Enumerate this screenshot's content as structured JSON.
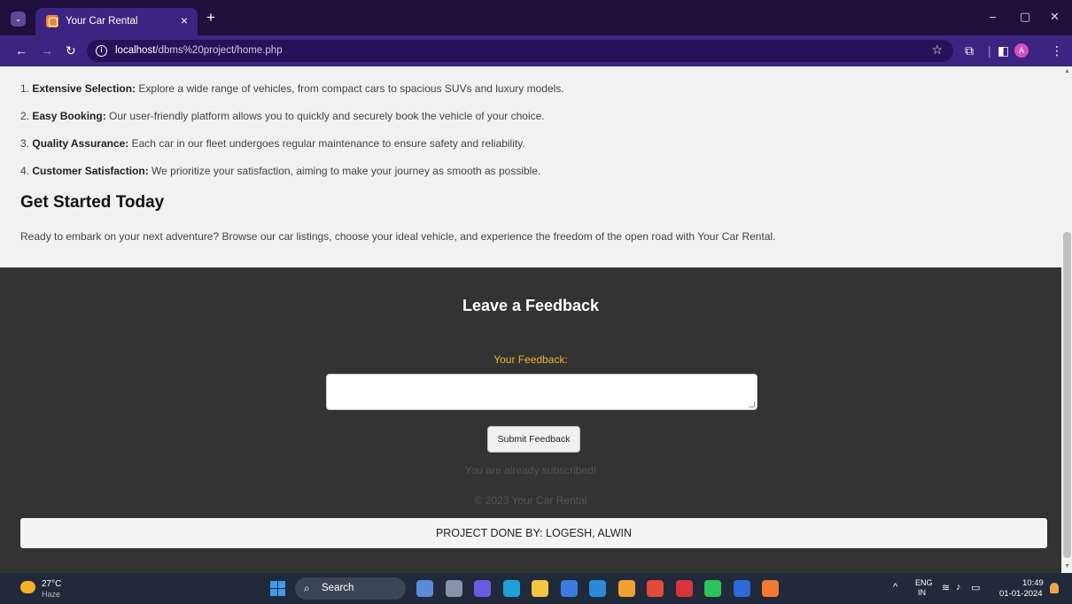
{
  "browser": {
    "tab_title": "Your Car Rental",
    "url_host": "localhost",
    "url_path": "/dbms%20project/home.php",
    "profile_initial": "A",
    "theme_color": "#3b2580"
  },
  "page": {
    "features": [
      {
        "number": "1.",
        "title": "Extensive Selection:",
        "text": " Explore a wide range of vehicles, from compact cars to spacious SUVs and luxury models."
      },
      {
        "number": "2.",
        "title": "Easy Booking:",
        "text": " Our user-friendly platform allows you to quickly and securely book the vehicle of your choice."
      },
      {
        "number": "3.",
        "title": "Quality Assurance:",
        "text": " Each car in our fleet undergoes regular maintenance to ensure safety and reliability."
      },
      {
        "number": "4.",
        "title": "Customer Satisfaction:",
        "text": " We prioritize your satisfaction, aiming to make your journey as smooth as possible."
      }
    ],
    "get_started_heading": "Get Started Today",
    "get_started_text": "Ready to embark on your next adventure? Browse our car listings, choose your ideal vehicle, and experience the freedom of the open road with Your Car Rental."
  },
  "footer": {
    "feedback_title": "Leave a Feedback",
    "feedback_label": "Your Feedback:",
    "feedback_value": "",
    "submit_label": "Submit Feedback",
    "subscribed_text": "You are already subscribed!",
    "copyright": "© 2023 Your Car Rental",
    "credits": "PROJECT DONE BY: LOGESH, ALWIN",
    "label_color": "#f5b324",
    "background_color": "#333333"
  },
  "taskbar": {
    "temperature": "27°C",
    "condition": "Haze",
    "search_label": "Search",
    "lang_top": "ENG",
    "lang_bottom": "IN",
    "time": "10:49",
    "date": "01-01-2024",
    "apps": [
      {
        "name": "widget-app-icon",
        "color": "#5b8ad8"
      },
      {
        "name": "task-view-icon",
        "color": "#8a94a8"
      },
      {
        "name": "meet-icon",
        "color": "#6a5be0"
      },
      {
        "name": "edge-icon",
        "color": "#1fa1d8"
      },
      {
        "name": "file-explorer-icon",
        "color": "#f4c542"
      },
      {
        "name": "store-icon",
        "color": "#3a7be0"
      },
      {
        "name": "mail-icon",
        "color": "#2a8ad8"
      },
      {
        "name": "photos-icon",
        "color": "#f0a030"
      },
      {
        "name": "chrome-icon",
        "color": "#e24a3a"
      },
      {
        "name": "mcafee-icon",
        "color": "#d8343a"
      },
      {
        "name": "whatsapp-icon",
        "color": "#2bc35a"
      },
      {
        "name": "word-icon",
        "color": "#2b6ad8"
      },
      {
        "name": "xampp-icon",
        "color": "#f07a30"
      }
    ]
  }
}
